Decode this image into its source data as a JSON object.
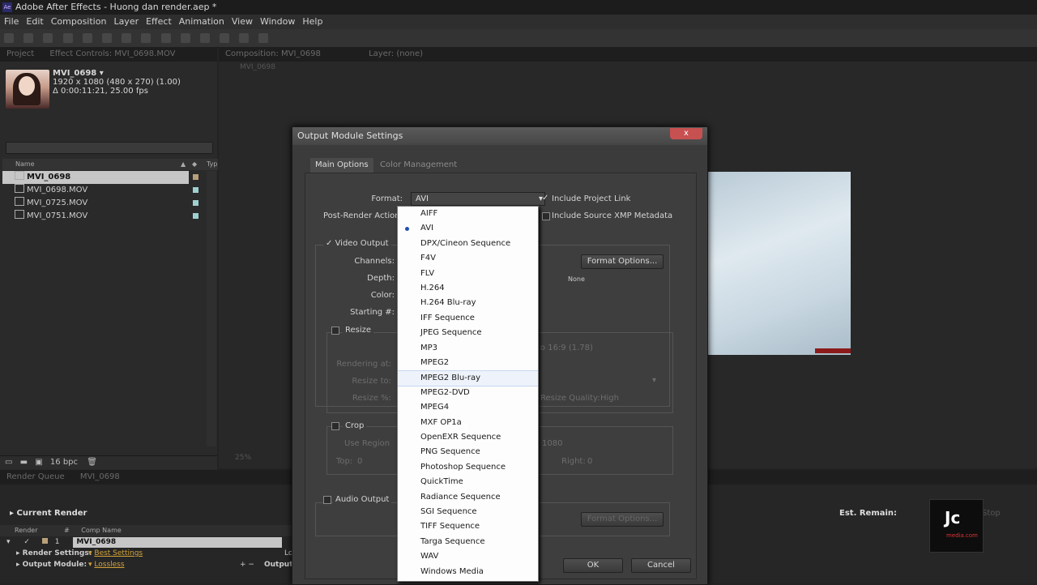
{
  "window": {
    "title": "Adobe After Effects - Huong dan render.aep *",
    "app_icon": "Ae"
  },
  "menu": [
    "File",
    "Edit",
    "Composition",
    "Layer",
    "Effect",
    "Animation",
    "View",
    "Window",
    "Help"
  ],
  "project_panel": {
    "tabs": [
      "Project",
      "Effect Controls: MVI_0698.MOV"
    ],
    "selected": {
      "name": "MVI_0698 ▾",
      "dims": "1920 x 1080  (480 x 270) (1.00)",
      "duration": "Δ 0:00:11:21, 25.00 fps"
    },
    "column_name": "Name",
    "column_type": "Typ",
    "items": [
      "MVI_0698",
      "MVI_0698.MOV",
      "MVI_0725.MOV",
      "MVI_0751.MOV"
    ],
    "bpc": "16 bpc"
  },
  "comp_panel": {
    "tab": "Composition: MVI_0698",
    "layer_tab": "Layer: (none)",
    "sub_tab": "MVI_0698",
    "zoom": "25%"
  },
  "render_queue": {
    "tabs": [
      "Render Queue",
      "MVI_0698"
    ],
    "current_render": "Current Render",
    "est_remain": "Est. Remain:",
    "stop": "Stop",
    "cols": [
      "Render",
      "#",
      "Comp Name"
    ],
    "row_num": "1",
    "comp_name": "MVI_0698",
    "render_settings_label": "Render Settings:",
    "render_settings_value": "Best Settings",
    "output_module_label": "Output Module:",
    "output_module_value": "Lossless",
    "output_to": "Output T",
    "log_trunc": "Lo"
  },
  "dialog": {
    "title": "Output Module Settings",
    "close": "x",
    "tabs": [
      "Main Options",
      "Color Management"
    ],
    "format_label": "Format:",
    "format_value": "AVI",
    "post_render_label": "Post-Render Action:",
    "include_project_link": "Include Project Link",
    "include_xmp": "Include Source XMP Metadata",
    "video_output": "Video Output",
    "channels": "Channels:",
    "depth": "Depth:",
    "color": "Color:",
    "starting": "Starting #:",
    "format_options": "Format Options...",
    "none": "None",
    "resize": "Resize",
    "rendering_at": "Rendering at:",
    "resize_to": "Resize to:",
    "resize_pct": "Resize %:",
    "lock_aspect": "to 16:9 (1.78)",
    "resize_quality_label": "Resize Quality:",
    "resize_quality_value": "High",
    "crop": "Crop",
    "use_region": "Use Region",
    "crop_dims": "1080",
    "top": "Top:",
    "top_value": "0",
    "right": "Right:",
    "right_value": "0",
    "audio_output": "Audio Output",
    "audio_format_options": "Format Options...",
    "ok": "OK",
    "cancel": "Cancel"
  },
  "format_options": [
    "AIFF",
    "AVI",
    "DPX/Cineon Sequence",
    "F4V",
    "FLV",
    "H.264",
    "H.264 Blu-ray",
    "IFF Sequence",
    "JPEG Sequence",
    "MP3",
    "MPEG2",
    "MPEG2 Blu-ray",
    "MPEG2-DVD",
    "MPEG4",
    "MXF OP1a",
    "OpenEXR Sequence",
    "PNG Sequence",
    "Photoshop Sequence",
    "QuickTime",
    "Radiance Sequence",
    "SGI Sequence",
    "TIFF Sequence",
    "Targa Sequence",
    "WAV",
    "Windows Media"
  ],
  "format_selected": "AVI",
  "format_hover": "MPEG2 Blu-ray",
  "watermark": {
    "logo": "Jc",
    "site": "media.com"
  }
}
